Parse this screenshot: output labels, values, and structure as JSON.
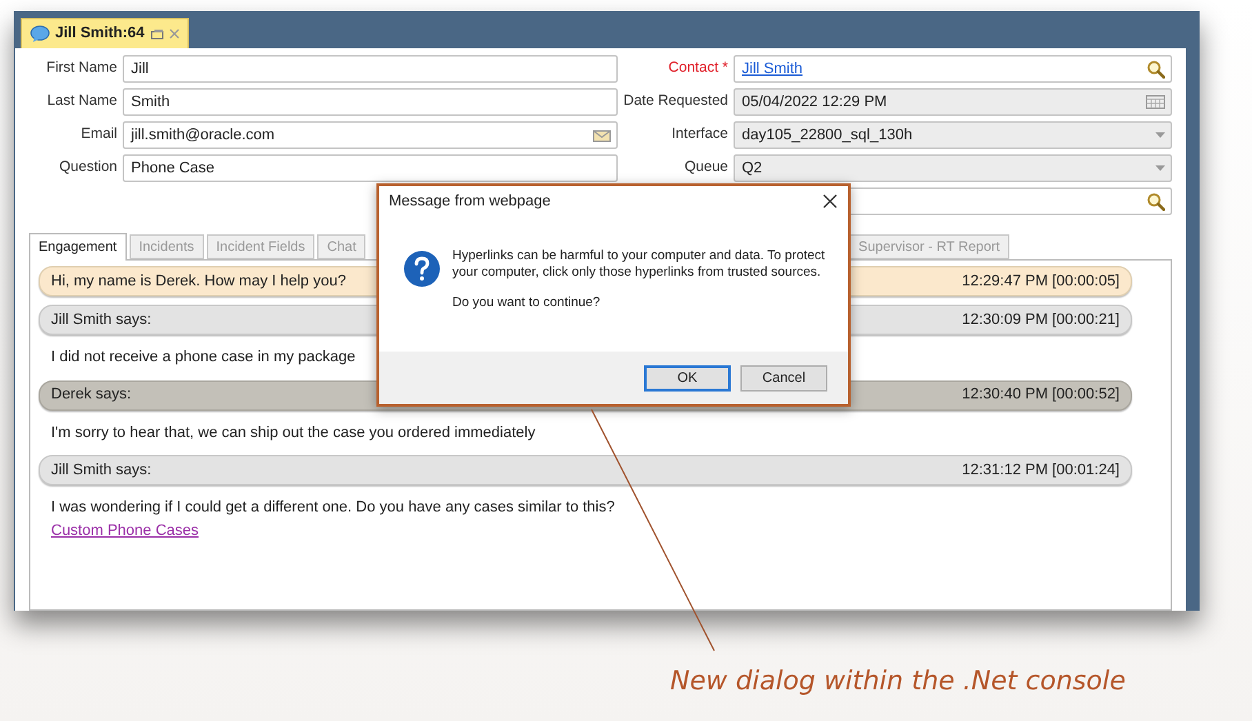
{
  "document_tab": {
    "title": "Jill Smith:64",
    "selected": true
  },
  "left_fields": [
    {
      "label": "First Name",
      "value": "Jill"
    },
    {
      "label": "Last Name",
      "value": "Smith"
    },
    {
      "label": "Email",
      "value": "jill.smith@oracle.com",
      "kind": "email"
    },
    {
      "label": "Question",
      "value": "Phone Case"
    }
  ],
  "right_fields": [
    {
      "label": "Contact *",
      "required": true,
      "value": "Jill Smith",
      "kind": "lookup",
      "link": true,
      "disabled": false
    },
    {
      "label": "Date Requested",
      "value": "05/04/2022 12:29 PM",
      "kind": "date",
      "disabled": true
    },
    {
      "label": "Interface",
      "value": "day105_22800_sql_130h",
      "kind": "dropdown",
      "disabled": true
    },
    {
      "label": "Queue",
      "value": "Q2",
      "kind": "dropdown",
      "disabled": true
    },
    {
      "kind": "lookup",
      "disabled": false
    }
  ],
  "tabs": [
    {
      "label": "Engagement",
      "selected": true
    },
    {
      "label": "Incidents",
      "selected": false
    },
    {
      "label": "Incident Fields",
      "selected": false
    },
    {
      "label": "Chat",
      "selected": false
    },
    {
      "label": "Supervisor - RT Report",
      "selected": false
    }
  ],
  "chat": [
    {
      "kind": "greeting",
      "text": "Hi, my name is Derek. How may I help you?",
      "time": "12:29:47 PM [00:00:05]"
    },
    {
      "kind": "customer",
      "text": "Jill Smith says:",
      "time": "12:30:09 PM [00:00:21]"
    },
    {
      "kind": "message",
      "text": "I did not receive a phone case in my package"
    },
    {
      "kind": "agent",
      "text": "Derek says:",
      "time": "12:30:40 PM [00:00:52]"
    },
    {
      "kind": "message",
      "text": "I'm sorry to hear that, we can ship out the case you ordered immediately"
    },
    {
      "kind": "customer",
      "text": "Jill Smith says:",
      "time": "12:31:12 PM [00:01:24]"
    },
    {
      "kind": "message",
      "text": "I was wondering if I could get a different one.  Do you have any cases similar to this?",
      "link": "Custom Phone Cases"
    }
  ],
  "dialog": {
    "title": "Message from webpage",
    "message": "Hyperlinks can be harmful to your computer and data.  To protect your computer, click only those hyperlinks from trusted sources.",
    "question": "Do you want to continue?",
    "buttons": [
      {
        "label": "OK",
        "default": true
      },
      {
        "label": "Cancel",
        "default": false
      }
    ]
  },
  "annotation": "New dialog within the .Net console"
}
